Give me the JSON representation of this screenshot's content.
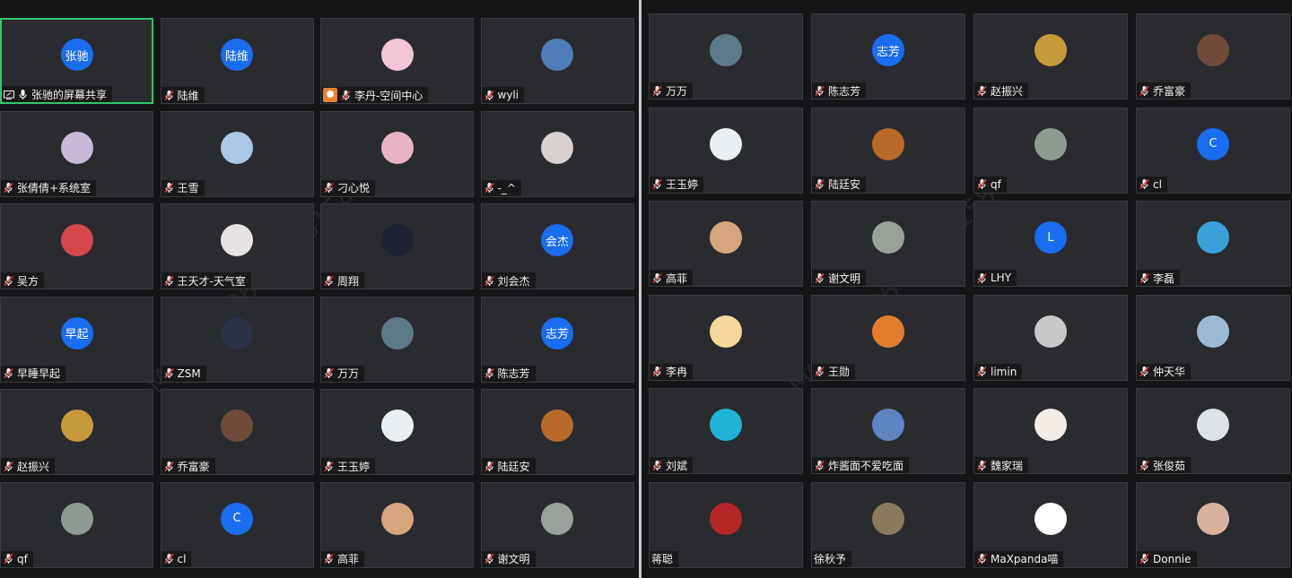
{
  "watermark": "Moana +86 187751587",
  "left_tiles": [
    {
      "name": "张驰的屏幕共享",
      "avatar_text": "张驰",
      "avatar_color": "#1a6cf0",
      "share": true,
      "active": true
    },
    {
      "name": "陆维",
      "avatar_text": "陆维",
      "avatar_color": "#1a6cf0"
    },
    {
      "name": "李丹-空间中心",
      "avatar_color": "#f1c6d6",
      "orange": true
    },
    {
      "name": "wyli",
      "avatar_color": "#4f7db8"
    },
    {
      "name": "张倩倩+系统室",
      "avatar_color": "#c9b8d8"
    },
    {
      "name": "王雪",
      "avatar_color": "#a8c8e6"
    },
    {
      "name": "刁心悦",
      "avatar_color": "#e7b4c4"
    },
    {
      "name": "-_^",
      "avatar_color": "#d9d0cf"
    },
    {
      "name": "吴方",
      "avatar_color": "#d6474b"
    },
    {
      "name": "王天才-天气室",
      "avatar_color": "#e8e3e3"
    },
    {
      "name": "周翔",
      "avatar_color": "#1f2233"
    },
    {
      "name": "刘会杰",
      "avatar_text": "会杰",
      "avatar_color": "#1a6cf0"
    },
    {
      "name": "早睡早起",
      "avatar_text": "早起",
      "avatar_color": "#1a6cf0"
    },
    {
      "name": "ZSM",
      "avatar_color": "#2b3146"
    },
    {
      "name": "万万",
      "avatar_color": "#5d7a89"
    },
    {
      "name": "陈志芳",
      "avatar_text": "志芳",
      "avatar_color": "#1a6cf0"
    },
    {
      "name": "赵振兴",
      "avatar_color": "#c79a3c"
    },
    {
      "name": "乔富豪",
      "avatar_color": "#6e4c39"
    },
    {
      "name": "王玉婷",
      "avatar_color": "#e8f0f2"
    },
    {
      "name": "陆廷安",
      "avatar_color": "#b76a2a"
    },
    {
      "name": "qf",
      "avatar_color": "#8e9b92"
    },
    {
      "name": "cl",
      "avatar_text": "C",
      "avatar_color": "#1a6cf0"
    },
    {
      "name": "高菲",
      "avatar_color": "#d5a57e"
    },
    {
      "name": "谢文明",
      "avatar_color": "#9aa19b"
    }
  ],
  "right_tiles": [
    {
      "name": "万万",
      "avatar_color": "#5d7a89"
    },
    {
      "name": "陈志芳",
      "avatar_text": "志芳",
      "avatar_color": "#1a6cf0"
    },
    {
      "name": "赵振兴",
      "avatar_color": "#c79a3c"
    },
    {
      "name": "乔富豪",
      "avatar_color": "#6e4c39"
    },
    {
      "name": "王玉婷",
      "avatar_color": "#e8f0f2"
    },
    {
      "name": "陆廷安",
      "avatar_color": "#b76a2a"
    },
    {
      "name": "qf",
      "avatar_color": "#8e9b92"
    },
    {
      "name": "cl",
      "avatar_text": "C",
      "avatar_color": "#1a6cf0"
    },
    {
      "name": "高菲",
      "avatar_color": "#d5a57e"
    },
    {
      "name": "谢文明",
      "avatar_color": "#9aa19b"
    },
    {
      "name": "LHY",
      "avatar_text": "L",
      "avatar_color": "#1a6cf0"
    },
    {
      "name": "李磊",
      "avatar_color": "#3aa0d8"
    },
    {
      "name": "李冉",
      "avatar_color": "#f3d89a"
    },
    {
      "name": "王勋",
      "avatar_color": "#e47d2b"
    },
    {
      "name": "limin",
      "avatar_color": "#c8c8c8"
    },
    {
      "name": "仲天华",
      "avatar_color": "#9db9d2"
    },
    {
      "name": "刘斌",
      "avatar_color": "#1fb4d8"
    },
    {
      "name": "炸酱面不爱吃面",
      "avatar_color": "#5e84c2"
    },
    {
      "name": "魏家瑞",
      "avatar_color": "#f2ebe6"
    },
    {
      "name": "张俊茹",
      "avatar_color": "#dfe3e8"
    },
    {
      "name": "蒋聪",
      "avatar_color": "#b52727",
      "no_mic": true
    },
    {
      "name": "徐秋予",
      "avatar_color": "#8a7a5e",
      "no_mic": true
    },
    {
      "name": "MaXpanda喵",
      "avatar_color": "#ffffff"
    },
    {
      "name": "Donnie",
      "avatar_color": "#d7b29f"
    }
  ]
}
